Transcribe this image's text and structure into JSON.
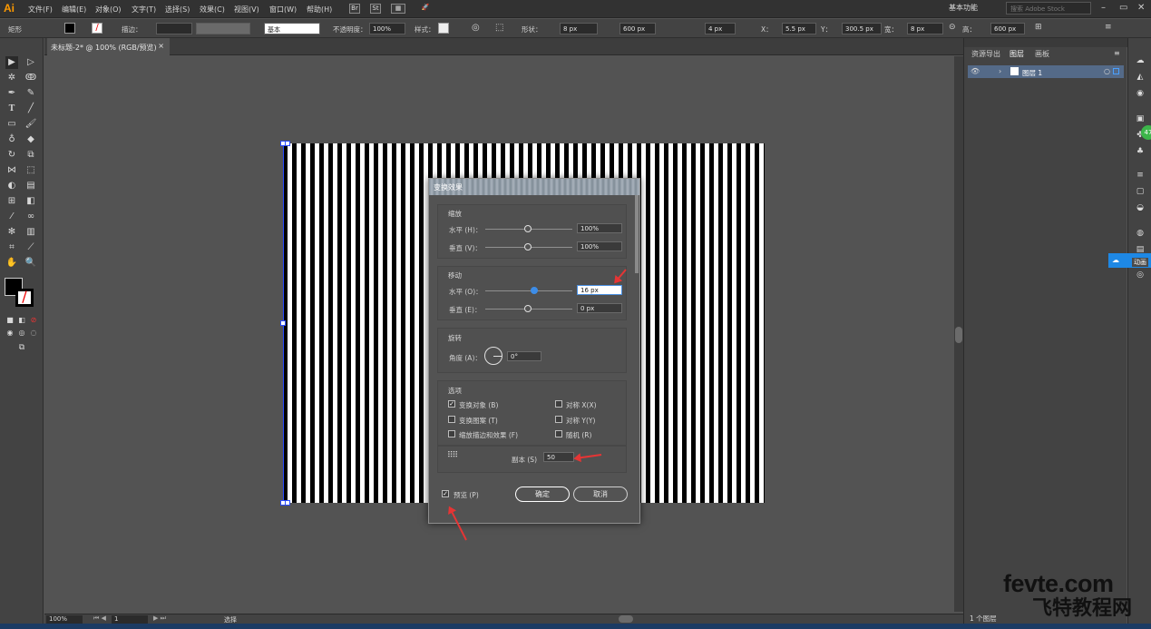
{
  "app": {
    "logo": "Ai",
    "workspace": "基本功能",
    "stock_placeholder": "搜索 Adobe Stock"
  },
  "menu": [
    "文件(F)",
    "编辑(E)",
    "对象(O)",
    "文字(T)",
    "选择(S)",
    "效果(C)",
    "视图(V)",
    "窗口(W)",
    "帮助(H)"
  ],
  "menubar_icons": {
    "br": "Br",
    "st": "St"
  },
  "control": {
    "object_type": "矩形",
    "stroke_label": "描边：",
    "stroke_profile": "基本",
    "opacity_label": "不透明度：",
    "opacity": "100%",
    "style_label": "样式：",
    "shape_label": "形状：",
    "shape_w": "8 px",
    "shape_w2": "600 px",
    "corner": "4 px",
    "x_label": "X：",
    "x": "5.5 px",
    "y_label": "Y：",
    "y": "300.5 px",
    "w_label": "宽：",
    "w": "8 px",
    "h_label": "高：",
    "h": "600 px"
  },
  "document": {
    "tab": "未标题-2* @ 100% (RGB/预览)",
    "close": "×"
  },
  "panel": {
    "tabs": [
      "资源导出",
      "图层",
      "画板"
    ],
    "layer_name": "图层 1",
    "layer_count": "1 个图层"
  },
  "status": {
    "zoom": "100%",
    "page": "1",
    "tool": "选择"
  },
  "dialog": {
    "title": "变换效果",
    "scale_title": "缩放",
    "scale_h_label": "水平 (H)：",
    "scale_h": "100%",
    "scale_v_label": "垂直 (V)：",
    "scale_v": "100%",
    "move_title": "移动",
    "move_h_label": "水平 (O)：",
    "move_h": "16 px",
    "move_v_label": "垂直 (E)：",
    "move_v": "0 px",
    "rotate_title": "旋转",
    "angle_label": "角度 (A)：",
    "angle": "0°",
    "options_title": "选项",
    "opt_transform_objects": "变换对象 (B)",
    "opt_transform_patterns": "变换图案 (T)",
    "opt_scale_strokes": "缩放描边和效果 (F)",
    "opt_reflect_x": "对称 X(X)",
    "opt_reflect_y": "对称 Y(Y)",
    "opt_random": "随机 (R)",
    "copies_label": "副本 (S)",
    "copies": "50",
    "preview_label": "预览 (P)",
    "ok": "确定",
    "cancel": "取消"
  },
  "tooltip": "动画",
  "watermark": {
    "line1": "fevte.com",
    "line2": "飞特教程网"
  }
}
